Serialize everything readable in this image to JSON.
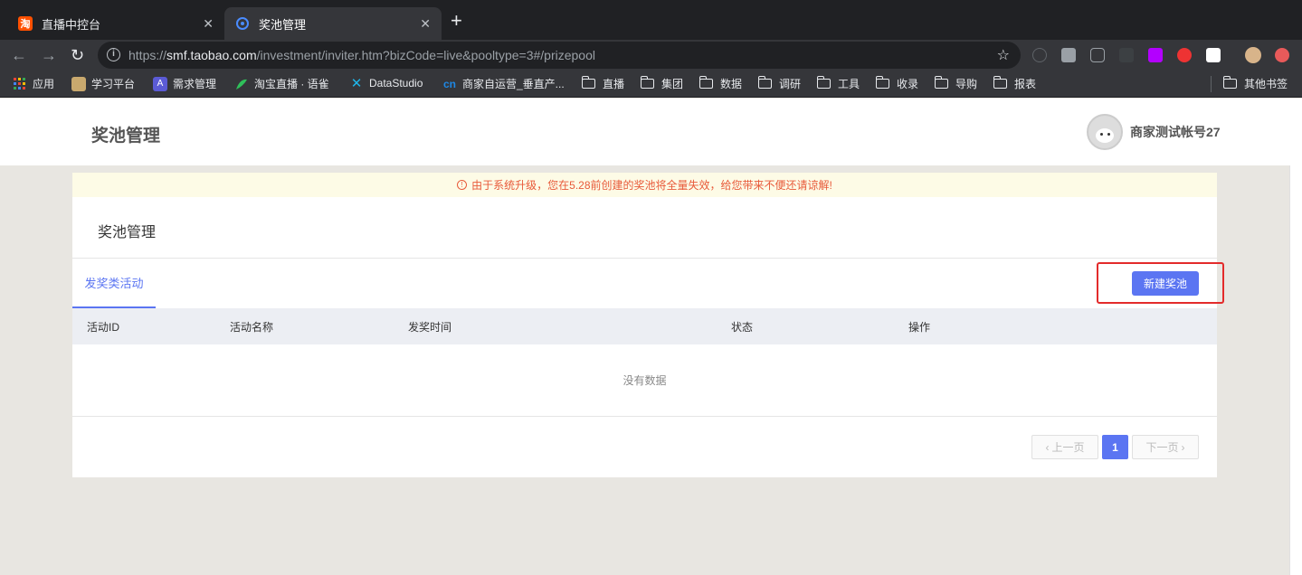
{
  "browser": {
    "tabs": [
      {
        "title": "直播中控台",
        "favicon": "淘"
      },
      {
        "title": "奖池管理"
      }
    ],
    "url_prefix": "https://",
    "url_host": "smf.taobao.com",
    "url_path": "/investment/inviter.htm?bizCode=live&pooltype=3#/prizepool",
    "bookmarks": [
      {
        "label": "应用",
        "icon": "apps-grid"
      },
      {
        "label": "学习平台",
        "icon": "study-logo"
      },
      {
        "label": "需求管理",
        "icon": "A",
        "icon_char": "A"
      },
      {
        "label": "淘宝直播 · 语雀",
        "icon": "yuque-logo"
      },
      {
        "label": "DataStudio",
        "icon": "datastudio-logo"
      },
      {
        "label": "商家自运营_垂直产...",
        "icon": "aliyun-logo"
      },
      {
        "label": "直播",
        "icon": "folder"
      },
      {
        "label": "集团",
        "icon": "folder"
      },
      {
        "label": "数据",
        "icon": "folder"
      },
      {
        "label": "调研",
        "icon": "folder"
      },
      {
        "label": "工具",
        "icon": "folder"
      },
      {
        "label": "收录",
        "icon": "folder"
      },
      {
        "label": "导购",
        "icon": "folder"
      },
      {
        "label": "报表",
        "icon": "folder"
      }
    ],
    "other_bookmarks": "其他书签"
  },
  "header": {
    "title": "奖池管理",
    "username": "商家测试帐号27"
  },
  "notice": {
    "icon": "!",
    "text": "由于系统升级，您在5.28前创建的奖池将全量失效，给您带来不便还请谅解!"
  },
  "main": {
    "section_title": "奖池管理",
    "tab_label": "发奖类活动",
    "new_button": "新建奖池",
    "columns": [
      "活动ID",
      "活动名称",
      "发奖时间",
      "状态",
      "操作"
    ],
    "empty_text": "没有数据",
    "pagination": {
      "prev": "上一页",
      "current": "1",
      "next": "下一页"
    }
  },
  "colors": {
    "accent": "#5b75f2",
    "highlight_box": "#e32b2b",
    "notice_text": "#e85a3a",
    "notice_bg": "#fdfbe6"
  }
}
